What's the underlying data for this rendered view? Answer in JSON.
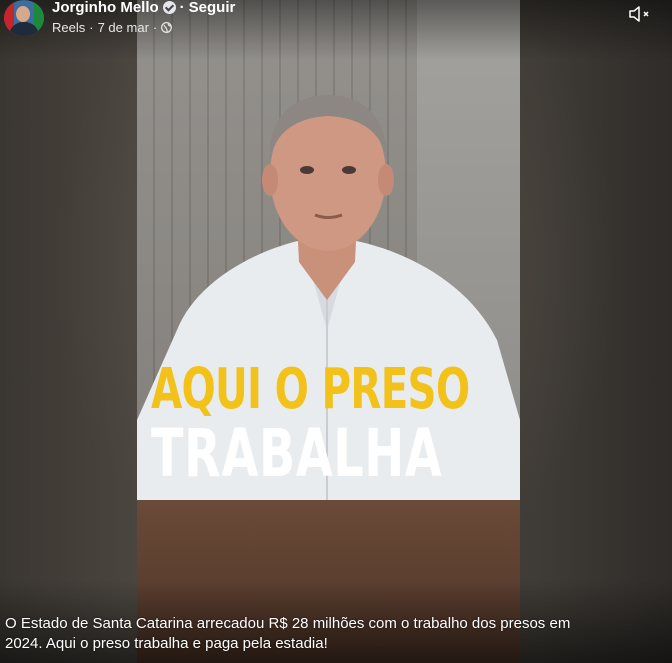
{
  "post": {
    "author": "Jorginho Mello",
    "separator": "·",
    "follow_label": "Seguir",
    "category": "Reels",
    "date": "7 de mar",
    "sub_separator1": "·",
    "sub_separator2": "·"
  },
  "video": {
    "headline_line1": "AQUI O PRESO",
    "headline_line2": "TRABALHA"
  },
  "caption": "O Estado de Santa Catarina arrecadou R$ 28 milhões com o trabalho dos presos em 2024. Aqui o preso trabalha e paga pela estadia!",
  "colors": {
    "headline_yellow": "#f2c21a",
    "text_white": "#ffffff"
  },
  "icons": [
    "verified-icon",
    "globe-icon",
    "speaker-muted-icon"
  ]
}
